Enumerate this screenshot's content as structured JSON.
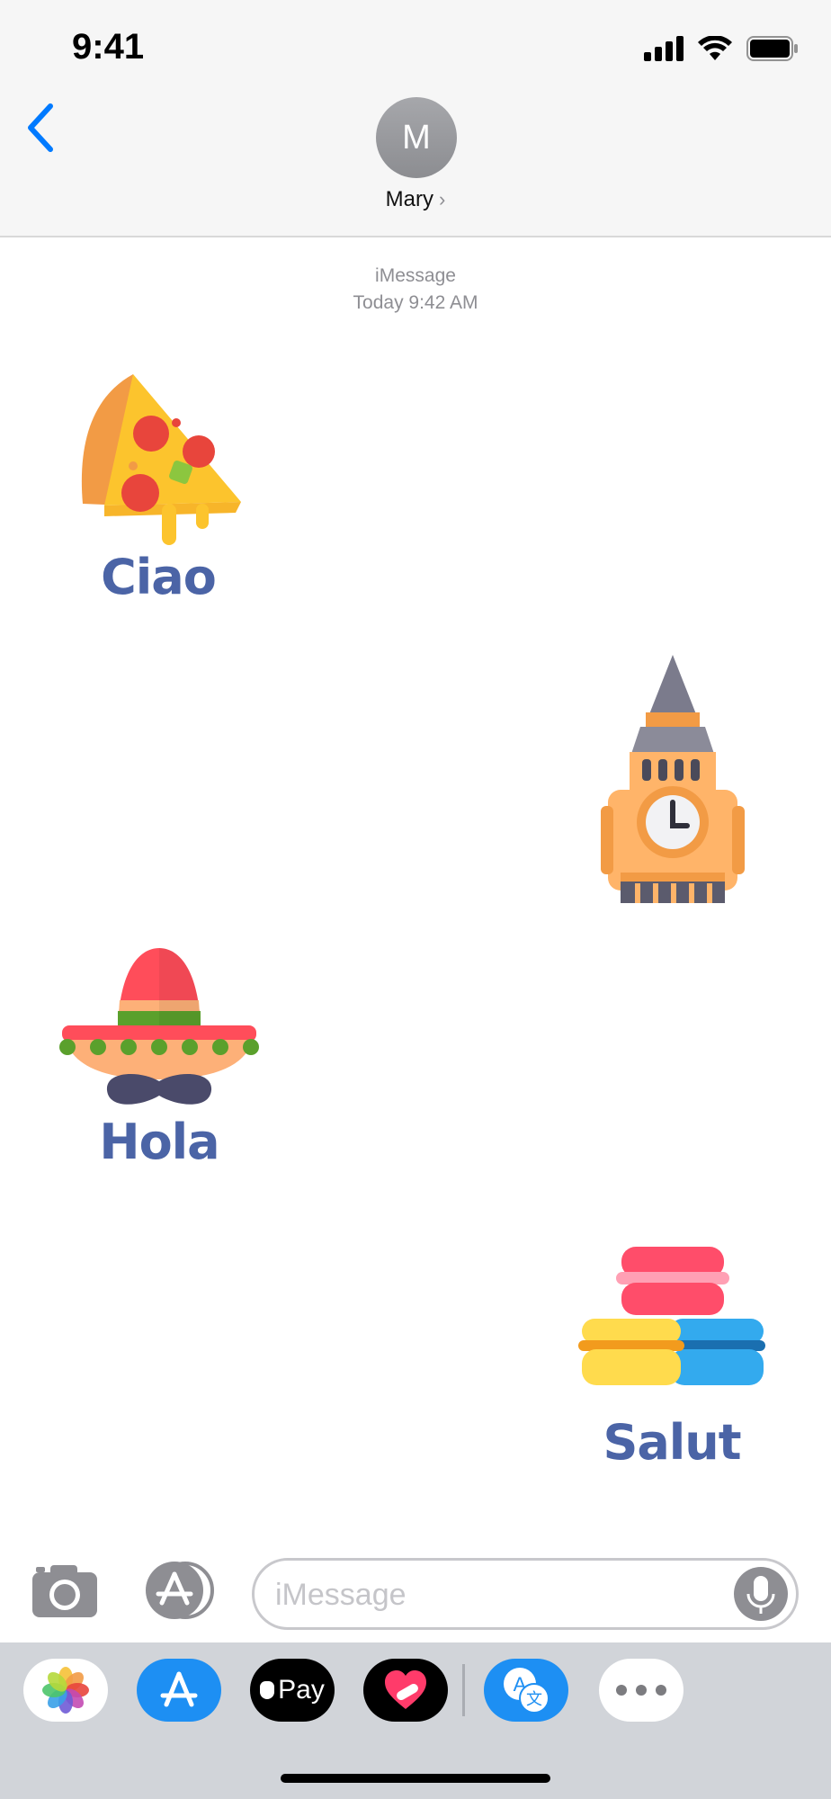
{
  "status_bar": {
    "time": "9:41"
  },
  "header": {
    "back_label": "Back",
    "avatar_initial": "M",
    "contact_name": "Mary"
  },
  "meta": {
    "service": "iMessage",
    "timestamp": "Today 9:42 AM"
  },
  "stickers": [
    {
      "icon": "pizza-icon",
      "label": "Ciao"
    },
    {
      "icon": "big-ben-icon",
      "label": ""
    },
    {
      "icon": "sombrero-icon",
      "label": "Hola"
    },
    {
      "icon": "macarons-icon",
      "label": "Salut"
    }
  ],
  "input_bar": {
    "placeholder": "iMessage"
  },
  "app_drawer": {
    "items": [
      {
        "icon": "photos-icon"
      },
      {
        "icon": "app-store-icon"
      },
      {
        "icon": "apple-pay-icon",
        "label": "Pay"
      },
      {
        "icon": "digital-touch-icon"
      },
      {
        "icon": "translate-icon"
      },
      {
        "icon": "more-icon"
      }
    ]
  },
  "colors": {
    "accent": "#007aff",
    "sticker_label": "#4b64a6"
  }
}
